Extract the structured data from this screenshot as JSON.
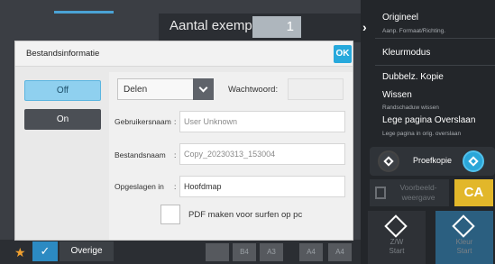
{
  "copier": {
    "copies_label": "Aantal exempl.",
    "copies_value": "1",
    "right_panel": {
      "items": [
        {
          "label": "Origineel",
          "sub": "Aanp. Formaat/Richting."
        },
        {
          "label": "Kleurmodus",
          "sub": ""
        },
        {
          "label": "Dubbelz. Kopie",
          "sub": ""
        },
        {
          "label": "Wissen",
          "sub": "Randschaduw wissen"
        },
        {
          "label": "Lege pagina Overslaan",
          "sub": "Lege pagina in orig. overslaan"
        }
      ],
      "proof_copy": "Proefkopie",
      "preview": "Voorbeeld-\nweergave",
      "ca": "CA",
      "start_bw": "Z/W\nStart",
      "start_color": "Kleur\nStart"
    },
    "bottom": {
      "other": "Overige",
      "paper_tiles": [
        "B4",
        "A4",
        "A3",
        "A4",
        "A4"
      ]
    }
  },
  "dialog": {
    "title": "Bestandsinformatie",
    "ok": "OK",
    "toggle_off": "Off",
    "toggle_on": "On",
    "share_value": "Delen",
    "password_label": "Wachtwoord:",
    "fields": [
      {
        "label": "Gebruikersnaam",
        "value": "User Unknown"
      },
      {
        "label": "Bestandsnaam",
        "value": "Copy_20230313_153004"
      },
      {
        "label": "Opgeslagen in",
        "value": "Hoofdmap"
      }
    ],
    "pdf_checkbox": "PDF maken voor surfen op pc"
  },
  "colors": {
    "accent": "#27a9dc",
    "selected_toggle": "#8fd0ef",
    "ca_button": "#e2b72a"
  }
}
